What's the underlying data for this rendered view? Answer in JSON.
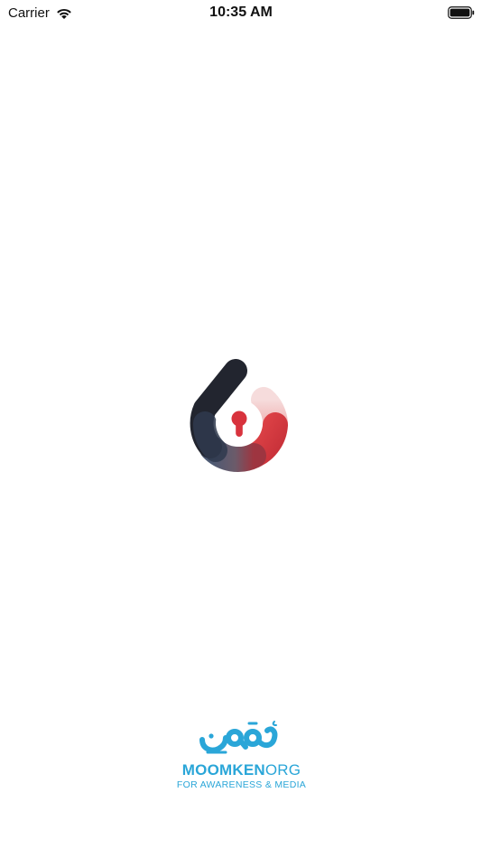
{
  "status_bar": {
    "carrier": "Carrier",
    "time": "10:35 AM",
    "wifi_icon": "wifi-icon",
    "battery_icon": "battery-icon"
  },
  "splash": {
    "app_logo_icon": "keyhole-lock-logo",
    "colors": {
      "dark": "#22252f",
      "slate": "#4b5871",
      "red": "#d93c42",
      "pink": "#f2c9c9",
      "keyhole": "#d8333d"
    }
  },
  "org": {
    "name_bold": "MOOMKEN",
    "name_light": "ORG",
    "tagline": "FOR AWARENESS & MEDIA",
    "brand_color": "#2aa6d8"
  }
}
